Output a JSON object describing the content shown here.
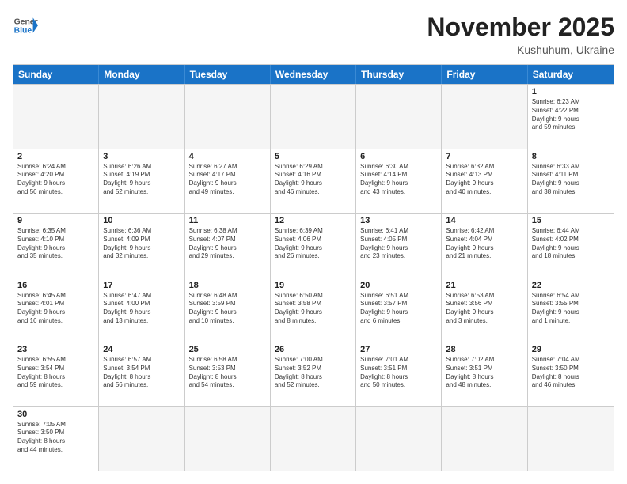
{
  "header": {
    "logo_general": "General",
    "logo_blue": "Blue",
    "month": "November 2025",
    "location": "Kushuhum, Ukraine"
  },
  "weekdays": [
    "Sunday",
    "Monday",
    "Tuesday",
    "Wednesday",
    "Thursday",
    "Friday",
    "Saturday"
  ],
  "rows": [
    [
      {
        "day": "",
        "info": "",
        "empty": true
      },
      {
        "day": "",
        "info": "",
        "empty": true
      },
      {
        "day": "",
        "info": "",
        "empty": true
      },
      {
        "day": "",
        "info": "",
        "empty": true
      },
      {
        "day": "",
        "info": "",
        "empty": true
      },
      {
        "day": "",
        "info": "",
        "empty": true
      },
      {
        "day": "1",
        "info": "Sunrise: 6:23 AM\nSunset: 4:22 PM\nDaylight: 9 hours\nand 59 minutes.",
        "empty": false
      }
    ],
    [
      {
        "day": "2",
        "info": "Sunrise: 6:24 AM\nSunset: 4:20 PM\nDaylight: 9 hours\nand 56 minutes.",
        "empty": false
      },
      {
        "day": "3",
        "info": "Sunrise: 6:26 AM\nSunset: 4:19 PM\nDaylight: 9 hours\nand 52 minutes.",
        "empty": false
      },
      {
        "day": "4",
        "info": "Sunrise: 6:27 AM\nSunset: 4:17 PM\nDaylight: 9 hours\nand 49 minutes.",
        "empty": false
      },
      {
        "day": "5",
        "info": "Sunrise: 6:29 AM\nSunset: 4:16 PM\nDaylight: 9 hours\nand 46 minutes.",
        "empty": false
      },
      {
        "day": "6",
        "info": "Sunrise: 6:30 AM\nSunset: 4:14 PM\nDaylight: 9 hours\nand 43 minutes.",
        "empty": false
      },
      {
        "day": "7",
        "info": "Sunrise: 6:32 AM\nSunset: 4:13 PM\nDaylight: 9 hours\nand 40 minutes.",
        "empty": false
      },
      {
        "day": "8",
        "info": "Sunrise: 6:33 AM\nSunset: 4:11 PM\nDaylight: 9 hours\nand 38 minutes.",
        "empty": false
      }
    ],
    [
      {
        "day": "9",
        "info": "Sunrise: 6:35 AM\nSunset: 4:10 PM\nDaylight: 9 hours\nand 35 minutes.",
        "empty": false
      },
      {
        "day": "10",
        "info": "Sunrise: 6:36 AM\nSunset: 4:09 PM\nDaylight: 9 hours\nand 32 minutes.",
        "empty": false
      },
      {
        "day": "11",
        "info": "Sunrise: 6:38 AM\nSunset: 4:07 PM\nDaylight: 9 hours\nand 29 minutes.",
        "empty": false
      },
      {
        "day": "12",
        "info": "Sunrise: 6:39 AM\nSunset: 4:06 PM\nDaylight: 9 hours\nand 26 minutes.",
        "empty": false
      },
      {
        "day": "13",
        "info": "Sunrise: 6:41 AM\nSunset: 4:05 PM\nDaylight: 9 hours\nand 23 minutes.",
        "empty": false
      },
      {
        "day": "14",
        "info": "Sunrise: 6:42 AM\nSunset: 4:04 PM\nDaylight: 9 hours\nand 21 minutes.",
        "empty": false
      },
      {
        "day": "15",
        "info": "Sunrise: 6:44 AM\nSunset: 4:02 PM\nDaylight: 9 hours\nand 18 minutes.",
        "empty": false
      }
    ],
    [
      {
        "day": "16",
        "info": "Sunrise: 6:45 AM\nSunset: 4:01 PM\nDaylight: 9 hours\nand 16 minutes.",
        "empty": false
      },
      {
        "day": "17",
        "info": "Sunrise: 6:47 AM\nSunset: 4:00 PM\nDaylight: 9 hours\nand 13 minutes.",
        "empty": false
      },
      {
        "day": "18",
        "info": "Sunrise: 6:48 AM\nSunset: 3:59 PM\nDaylight: 9 hours\nand 10 minutes.",
        "empty": false
      },
      {
        "day": "19",
        "info": "Sunrise: 6:50 AM\nSunset: 3:58 PM\nDaylight: 9 hours\nand 8 minutes.",
        "empty": false
      },
      {
        "day": "20",
        "info": "Sunrise: 6:51 AM\nSunset: 3:57 PM\nDaylight: 9 hours\nand 6 minutes.",
        "empty": false
      },
      {
        "day": "21",
        "info": "Sunrise: 6:53 AM\nSunset: 3:56 PM\nDaylight: 9 hours\nand 3 minutes.",
        "empty": false
      },
      {
        "day": "22",
        "info": "Sunrise: 6:54 AM\nSunset: 3:55 PM\nDaylight: 9 hours\nand 1 minute.",
        "empty": false
      }
    ],
    [
      {
        "day": "23",
        "info": "Sunrise: 6:55 AM\nSunset: 3:54 PM\nDaylight: 8 hours\nand 59 minutes.",
        "empty": false
      },
      {
        "day": "24",
        "info": "Sunrise: 6:57 AM\nSunset: 3:54 PM\nDaylight: 8 hours\nand 56 minutes.",
        "empty": false
      },
      {
        "day": "25",
        "info": "Sunrise: 6:58 AM\nSunset: 3:53 PM\nDaylight: 8 hours\nand 54 minutes.",
        "empty": false
      },
      {
        "day": "26",
        "info": "Sunrise: 7:00 AM\nSunset: 3:52 PM\nDaylight: 8 hours\nand 52 minutes.",
        "empty": false
      },
      {
        "day": "27",
        "info": "Sunrise: 7:01 AM\nSunset: 3:51 PM\nDaylight: 8 hours\nand 50 minutes.",
        "empty": false
      },
      {
        "day": "28",
        "info": "Sunrise: 7:02 AM\nSunset: 3:51 PM\nDaylight: 8 hours\nand 48 minutes.",
        "empty": false
      },
      {
        "day": "29",
        "info": "Sunrise: 7:04 AM\nSunset: 3:50 PM\nDaylight: 8 hours\nand 46 minutes.",
        "empty": false
      }
    ],
    [
      {
        "day": "30",
        "info": "Sunrise: 7:05 AM\nSunset: 3:50 PM\nDaylight: 8 hours\nand 44 minutes.",
        "empty": false
      },
      {
        "day": "",
        "info": "",
        "empty": true
      },
      {
        "day": "",
        "info": "",
        "empty": true
      },
      {
        "day": "",
        "info": "",
        "empty": true
      },
      {
        "day": "",
        "info": "",
        "empty": true
      },
      {
        "day": "",
        "info": "",
        "empty": true
      },
      {
        "day": "",
        "info": "",
        "empty": true
      }
    ]
  ]
}
